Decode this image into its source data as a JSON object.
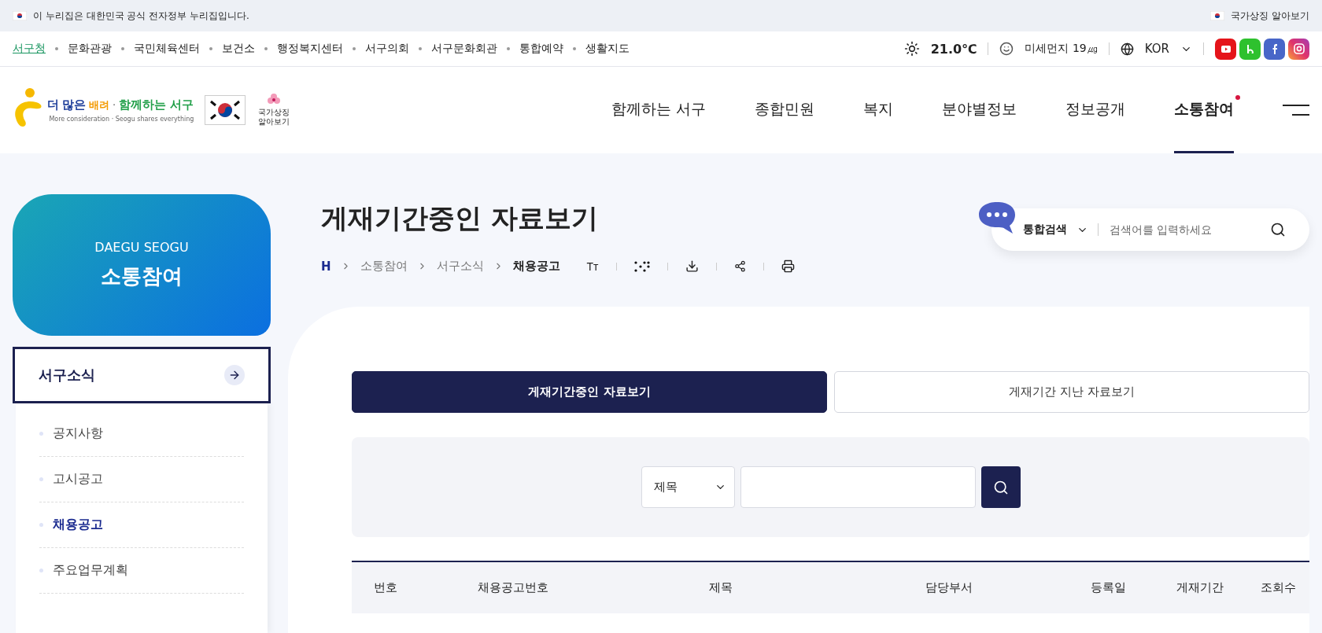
{
  "gov_banner": {
    "text": "이 누리집은 대한민국 공식 전자정부 누리집입니다.",
    "link": "국가상징 알아보기"
  },
  "util_links": [
    {
      "label": "서구청",
      "selected": true
    },
    {
      "label": "문화관광",
      "selected": false
    },
    {
      "label": "국민체육센터",
      "selected": false
    },
    {
      "label": "보건소",
      "selected": false
    },
    {
      "label": "행정복지센터",
      "selected": false
    },
    {
      "label": "서구의회",
      "selected": false
    },
    {
      "label": "서구문화회관",
      "selected": false
    },
    {
      "label": "통합예약",
      "selected": false
    },
    {
      "label": "생활지도",
      "selected": false
    }
  ],
  "weather": {
    "temperature": "21.0℃",
    "dust": "미세먼지 19㎍"
  },
  "language": "KOR",
  "logo": {
    "slogan_1": "더",
    "slogan_2": "많은",
    "slogan_3": "배려",
    "slogan_4": "·",
    "slogan_5": "함께하는 서구",
    "tagline": "More consideration · Seogu shares everything",
    "symbol_label": "국가상징 알아보기"
  },
  "main_nav": [
    {
      "label": "함께하는 서구",
      "selected": false,
      "dot": false
    },
    {
      "label": "종합민원",
      "selected": false,
      "dot": false
    },
    {
      "label": "복지",
      "selected": false,
      "dot": false
    },
    {
      "label": "분야별정보",
      "selected": false,
      "dot": false
    },
    {
      "label": "정보공개",
      "selected": false,
      "dot": false
    },
    {
      "label": "소통참여",
      "selected": true,
      "dot": true
    }
  ],
  "side": {
    "eyebrow": "DAEGU SEOGU",
    "title": "소통참여",
    "section": "서구소식",
    "items": [
      {
        "label": "공지사항",
        "selected": false
      },
      {
        "label": "고시공고",
        "selected": false
      },
      {
        "label": "채용공고",
        "selected": true
      },
      {
        "label": "주요업무계획",
        "selected": false
      }
    ]
  },
  "page_title": "게재기간중인 자료보기",
  "breadcrumb": [
    "H",
    "소통참여",
    "서구소식",
    "채용공고"
  ],
  "text_size_label": "Tт",
  "site_search": {
    "scope": "통합검색",
    "placeholder": "검색어를 입력하세요"
  },
  "tabs": [
    {
      "label": "게재기간중인 자료보기",
      "selected": true
    },
    {
      "label": "게재기간 지난 자료보기",
      "selected": false
    }
  ],
  "board_search": {
    "field": "제목"
  },
  "table": {
    "columns": [
      "번호",
      "채용공고번호",
      "제목",
      "담당부서",
      "등록일",
      "게재기간",
      "조회수"
    ]
  }
}
